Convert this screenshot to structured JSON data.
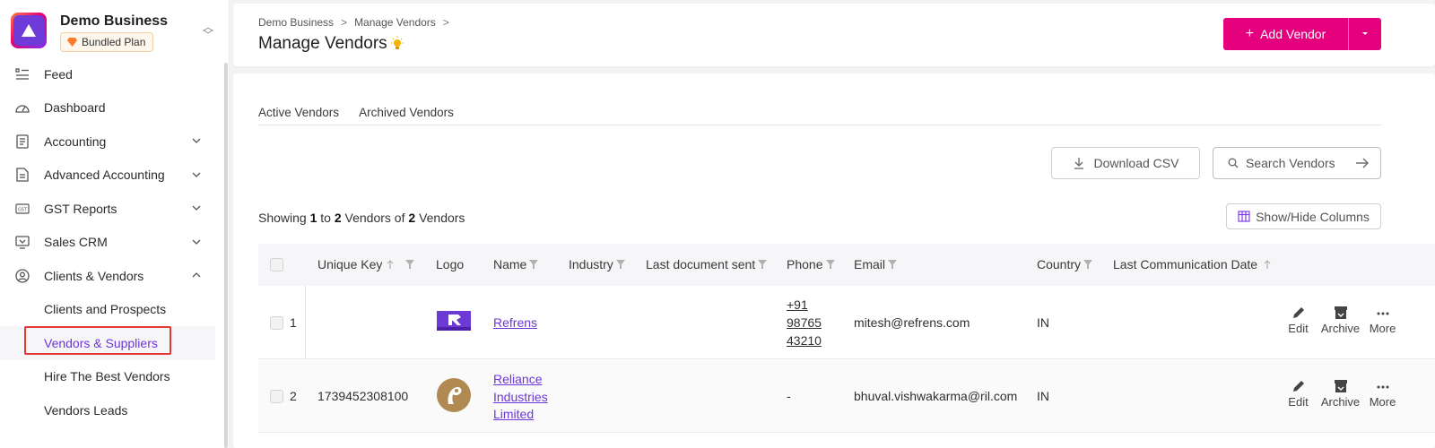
{
  "brand": {
    "name": "Demo Business",
    "plan": "Bundled Plan"
  },
  "sidebar": {
    "items": [
      {
        "label": "Feed",
        "icon": "feed-icon",
        "expandable": false
      },
      {
        "label": "Dashboard",
        "icon": "dashboard-icon",
        "expandable": false
      },
      {
        "label": "Accounting",
        "icon": "accounting-icon",
        "expandable": true
      },
      {
        "label": "Advanced Accounting",
        "icon": "document-icon",
        "expandable": true
      },
      {
        "label": "GST Reports",
        "icon": "gst-icon",
        "expandable": true
      },
      {
        "label": "Sales CRM",
        "icon": "crm-icon",
        "expandable": true
      },
      {
        "label": "Clients & Vendors",
        "icon": "user-circle-icon",
        "expandable": true,
        "expanded": true
      }
    ],
    "sub_items": [
      "Clients and Prospects",
      "Vendors & Suppliers",
      "Hire The Best Vendors",
      "Vendors Leads"
    ],
    "active_sub_item": "Vendors & Suppliers"
  },
  "header": {
    "breadcrumb": [
      "Demo Business",
      "Manage Vendors"
    ],
    "title": "Manage Vendors",
    "add_button": "Add Vendor"
  },
  "tabs": [
    "Active Vendors",
    "Archived Vendors"
  ],
  "toolbar": {
    "download_csv": "Download CSV",
    "search_placeholder": "Search Vendors",
    "show_hide_columns": "Show/Hide Columns"
  },
  "showing": {
    "prefix": "Showing",
    "from": "1",
    "to_word": "to",
    "to": "2",
    "mid": "Vendors of",
    "total": "2",
    "suffix": "Vendors"
  },
  "table": {
    "columns": [
      "Unique Key",
      "Logo",
      "Name",
      "Industry",
      "Last document sent",
      "Phone",
      "Email",
      "Country",
      "Last Communication Date"
    ],
    "rows": [
      {
        "index": "1",
        "unique_key": "",
        "logo": "refrens-logo",
        "name": [
          "Refrens"
        ],
        "industry": "",
        "last_document_sent": "",
        "phone": [
          "+91",
          "98765",
          "43210"
        ],
        "email": "mitesh@refrens.com",
        "country": "IN",
        "last_communication_date": ""
      },
      {
        "index": "2",
        "unique_key": "1739452308100",
        "logo": "reliance-logo",
        "name": [
          "Reliance",
          "Industries",
          "Limited"
        ],
        "industry": "",
        "last_document_sent": "",
        "phone": [
          "-"
        ],
        "email": "bhuval.vishwakarma@ril.com",
        "country": "IN",
        "last_communication_date": ""
      }
    ],
    "actions": [
      "Edit",
      "Archive",
      "More"
    ]
  },
  "colors": {
    "accent": "#e5007e",
    "link": "#6f35d8",
    "highlight": "#e53935"
  }
}
